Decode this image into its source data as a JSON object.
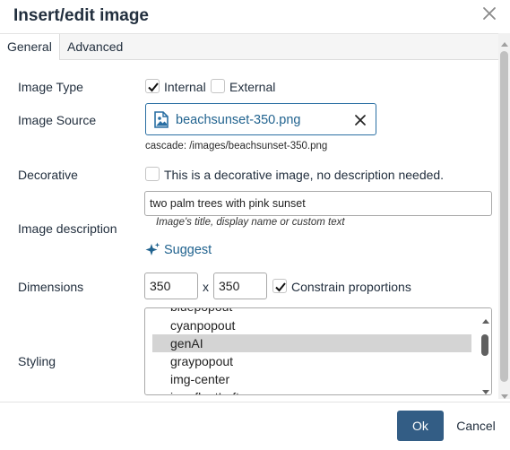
{
  "dialog": {
    "title": "Insert/edit image",
    "close_icon": "close-icon"
  },
  "tabs": [
    {
      "label": "General",
      "active": true
    },
    {
      "label": "Advanced",
      "active": false
    }
  ],
  "image_type": {
    "label": "Image Type",
    "internal_label": "Internal",
    "internal_checked": true,
    "external_label": "External",
    "external_checked": false
  },
  "image_source": {
    "label": "Image Source",
    "file_name": "beachsunset-350.png",
    "file_icon": "image-file-icon",
    "clear_icon": "close-icon",
    "path": "cascade: /images/beachsunset-350.png"
  },
  "decorative": {
    "label": "Decorative",
    "checkbox_label": "This is a decorative image, no description needed.",
    "checked": false
  },
  "description": {
    "label": "Image description",
    "value": "two palm trees with pink sunset",
    "hint": "Image's title, display name or custom text",
    "suggest_label": "Suggest",
    "suggest_icon": "sparkle-icon"
  },
  "dimensions": {
    "label": "Dimensions",
    "width": "350",
    "separator": "x",
    "height": "350",
    "constrain_label": "Constrain proportions",
    "constrain_checked": true
  },
  "styling": {
    "label": "Styling",
    "options": [
      "bluepopout",
      "cyanpopout",
      "genAI",
      "graypopout",
      "img-center",
      "img-floatLeft"
    ],
    "selected": "genAI"
  },
  "footer": {
    "ok_label": "Ok",
    "cancel_label": "Cancel"
  },
  "colors": {
    "primary": "#335d85",
    "link": "#21638f",
    "text": "#222f3e",
    "selected_bg": "#d4d4d4"
  }
}
